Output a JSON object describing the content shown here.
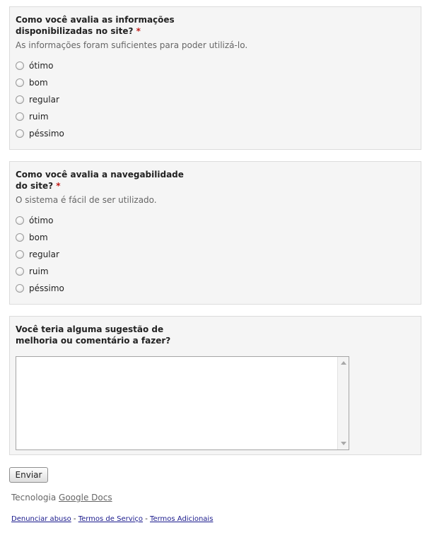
{
  "required_marker": "*",
  "questions": [
    {
      "title": "Como você avalia as informações disponibilizadas no site?",
      "help": "As informações foram suficientes para poder utilizá-lo.",
      "options": [
        "ótimo",
        "bom",
        "regular",
        "ruim",
        "péssimo"
      ]
    },
    {
      "title": "Como você avalia a navegabilidade do site?",
      "help": "O sistema é fácil de ser utilizado.",
      "options": [
        "ótimo",
        "bom",
        "regular",
        "ruim",
        "péssimo"
      ]
    },
    {
      "title": "Você teria alguma sugestão de melhoria ou comentário a fazer?",
      "value": ""
    }
  ],
  "submit_label": "Enviar",
  "powered_by": {
    "prefix": "Tecnologia",
    "link": "Google Docs"
  },
  "footer": {
    "links": [
      "Denunciar abuso",
      "Termos de Serviço",
      "Termos Adicionais"
    ],
    "separator": "-"
  },
  "colors": {
    "panel_background": "#f5f5f5",
    "required_marker": "#c11b17",
    "help_text": "#666666",
    "footer_link": "#1a1a8c"
  }
}
